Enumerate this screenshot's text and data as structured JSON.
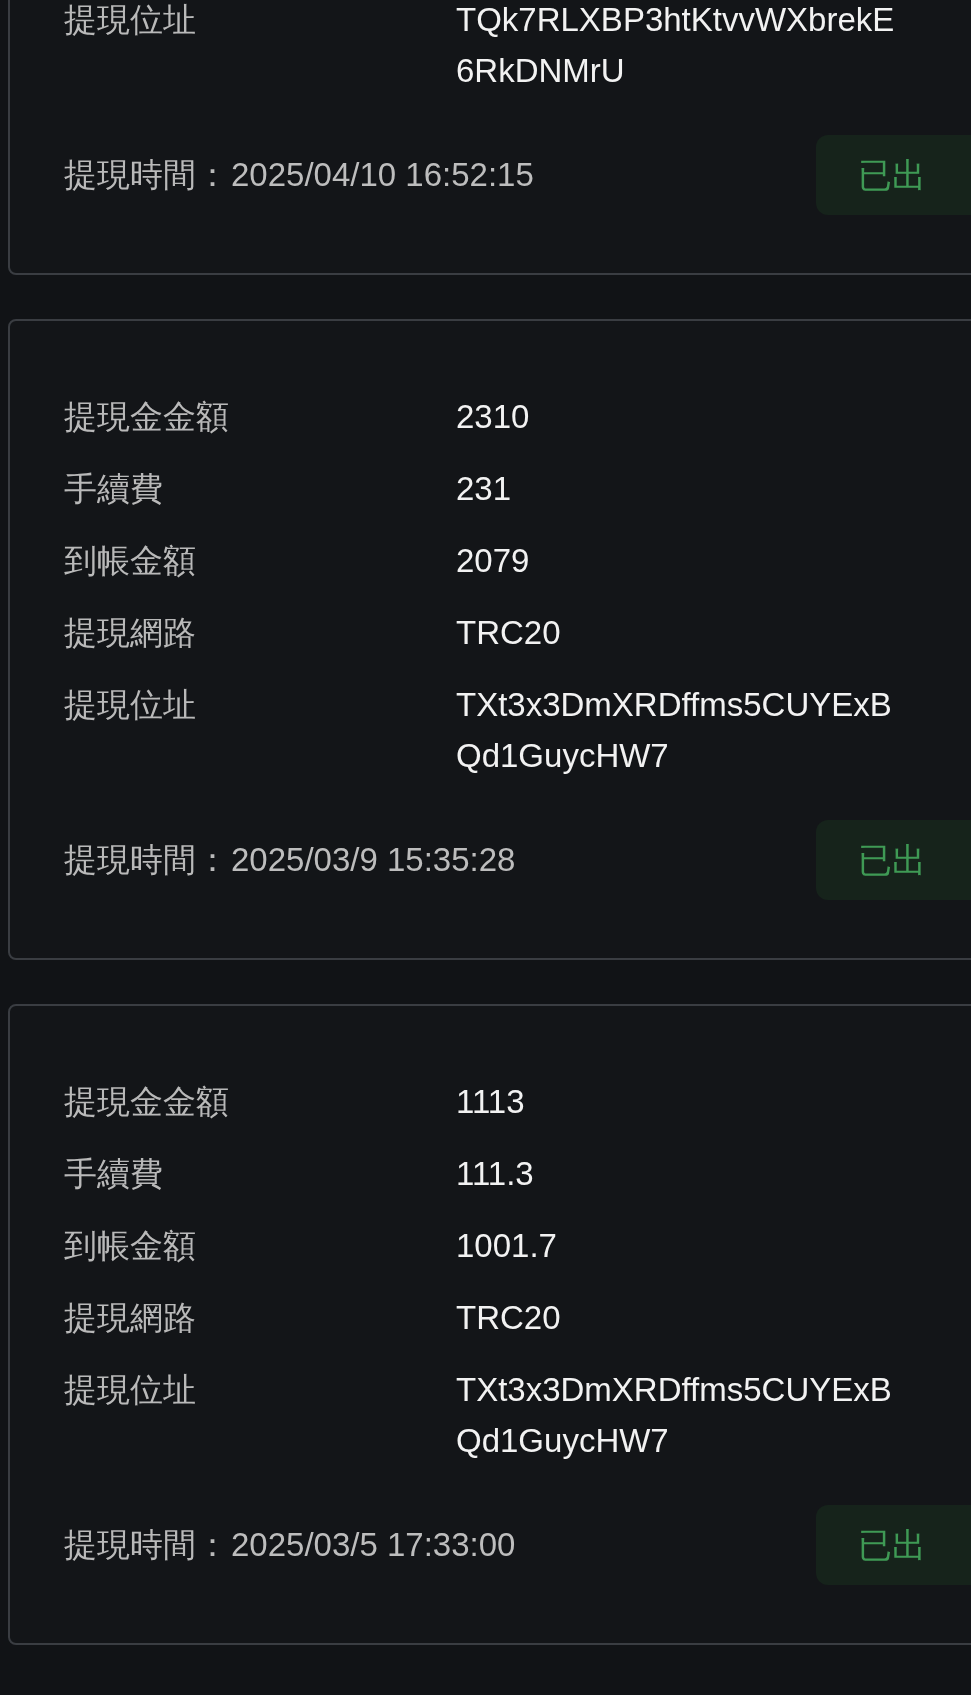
{
  "withdrawals": [
    {
      "fields": [
        {
          "label": "提現位址",
          "lines": [
            "TQk7RLXBP3htKtvvWXbrekE",
            "6RkDNMrU"
          ]
        }
      ],
      "time_label": "提現時間：",
      "time": "2025/04/10 16:52:15",
      "status": "已出"
    },
    {
      "fields": [
        {
          "label": "提現金金額",
          "lines": [
            "2310"
          ]
        },
        {
          "label": "手續費",
          "lines": [
            "231"
          ]
        },
        {
          "label": "到帳金額",
          "lines": [
            "2079"
          ]
        },
        {
          "label": "提現網路",
          "lines": [
            "TRC20"
          ]
        },
        {
          "label": "提現位址",
          "lines": [
            "TXt3x3DmXRDffms5CUYExB",
            "Qd1GuycHW7"
          ]
        }
      ],
      "time_label": "提現時間：",
      "time": "2025/03/9 15:35:28",
      "status": "已出"
    },
    {
      "fields": [
        {
          "label": "提現金金額",
          "lines": [
            "1113"
          ]
        },
        {
          "label": "手續費",
          "lines": [
            "111.3"
          ]
        },
        {
          "label": "到帳金額",
          "lines": [
            "1001.7"
          ]
        },
        {
          "label": "提現網路",
          "lines": [
            "TRC20"
          ]
        },
        {
          "label": "提現位址",
          "lines": [
            "TXt3x3DmXRDffms5CUYExB",
            "Qd1GuycHW7"
          ]
        }
      ],
      "time_label": "提現時間：",
      "time": "2025/03/5 17:33:00",
      "status": "已出"
    }
  ]
}
